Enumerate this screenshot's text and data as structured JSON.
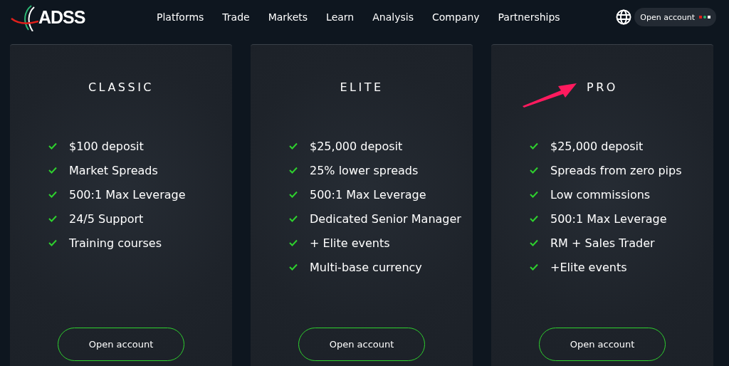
{
  "header": {
    "logo": "ADSS",
    "nav": [
      "Platforms",
      "Trade",
      "Markets",
      "Learn",
      "Analysis",
      "Company",
      "Partnerships"
    ],
    "open_account": "Open account"
  },
  "plans": [
    {
      "title": "CLASSIC",
      "features": [
        "$100 deposit",
        "Market Spreads",
        "500:1 Max Leverage",
        "24/5 Support",
        "Training courses"
      ],
      "button": "Open account",
      "highlighted": false
    },
    {
      "title": "ELITE",
      "features": [
        "$25,000 deposit",
        "25% lower spreads",
        "500:1 Max Leverage",
        "Dedicated Senior Manager",
        "+ Elite events",
        "Multi-base currency"
      ],
      "button": "Open account",
      "highlighted": false
    },
    {
      "title": "PRO",
      "features": [
        "$25,000 deposit",
        "Spreads from zero pips",
        "Low commissions",
        "500:1 Max Leverage",
        "RM + Sales Trader",
        "+Elite events"
      ],
      "button": "Open account",
      "highlighted": true
    }
  ]
}
